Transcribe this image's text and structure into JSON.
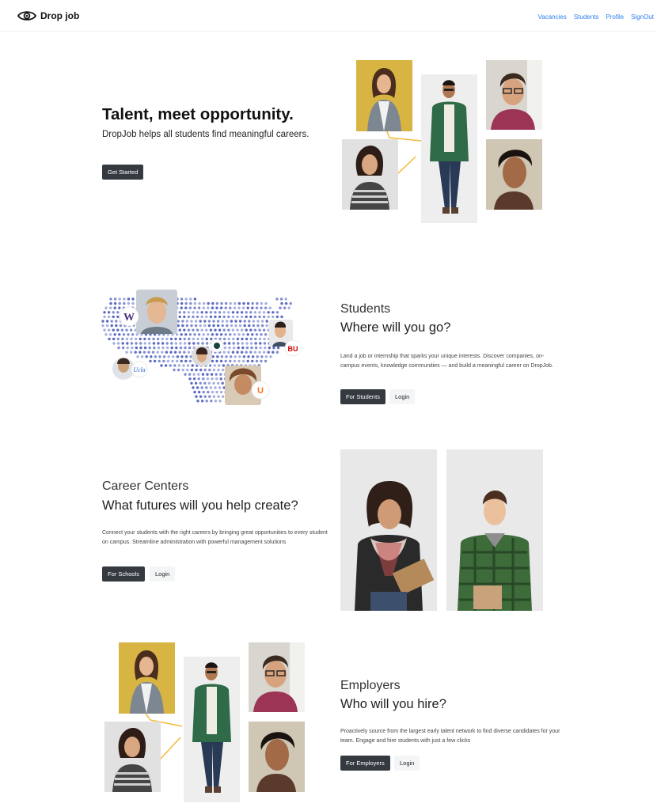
{
  "nav": {
    "brand": "Drop job",
    "links": [
      "Vacancies",
      "Students",
      "Profile",
      "SignOut"
    ]
  },
  "hero": {
    "title": "Talent, meet opportunity.",
    "subtitle": "DropJob helps all students find meaningful careers.",
    "cta": "Get Started"
  },
  "students": {
    "kicker": "Students",
    "title": "Where will you go?",
    "text": "Land a job or internship that sparks your unique interests. Discover companies, on-campus events, knowledge communities — and build a meaningful career on DropJob.",
    "primary": "For Students",
    "secondary": "Login",
    "logos": {
      "w": "W",
      "ucla": "Ucla",
      "bu": "BU",
      "u": "U"
    }
  },
  "career": {
    "kicker": "Career Centers",
    "title": "What futures will you help create?",
    "text": "Connect your students with the right careers by bringing great opportunities to every student on campus. Streamline administration with powerful management solutions",
    "primary": "For Schools",
    "secondary": "Login"
  },
  "employers": {
    "kicker": "Employers",
    "title": "Who will you hire?",
    "text": "Proactively source from the largest early talent network to find diverse candidates for your team. Engage and hire students with just a few clicks",
    "primary": "For Employers",
    "secondary": "Login"
  },
  "colors": {
    "accent_link": "#2f80ed",
    "button_dark": "#343a40",
    "connector": "#f3b938",
    "map_dots": "#5c6bc0"
  }
}
